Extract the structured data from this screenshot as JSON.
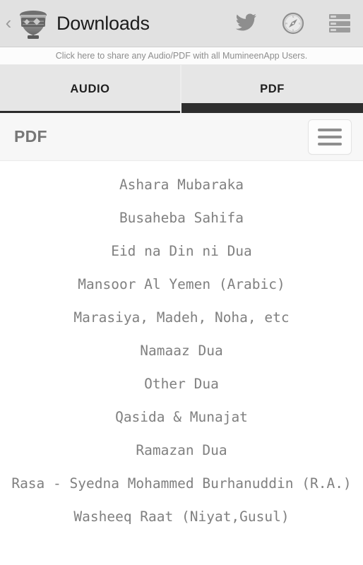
{
  "header": {
    "back_label": "‹",
    "logo_icon": "urn-logo-icon",
    "title": "Downloads",
    "actions": [
      {
        "name": "twitter-icon",
        "label": "Twitter"
      },
      {
        "name": "compass-icon",
        "label": "Browser"
      },
      {
        "name": "list-menu-icon",
        "label": "Menu"
      }
    ]
  },
  "share_banner": {
    "text": "Click here to share any Audio/PDF with all MumineenApp Users."
  },
  "tabs": [
    {
      "label": "AUDIO",
      "active": false
    },
    {
      "label": "PDF",
      "active": true
    }
  ],
  "section": {
    "title": "PDF",
    "menu_icon": "hamburger-icon"
  },
  "pdf_list": {
    "items": [
      "Ashara Mubaraka",
      "Busaheba Sahifa",
      "Eid na Din ni Dua",
      "Mansoor Al Yemen (Arabic)",
      "Marasiya, Madeh, Noha, etc",
      "Namaaz Dua",
      "Other Dua",
      "Qasida & Munajat",
      "Ramazan Dua",
      "Rasa - Syedna Mohammed Burhanuddin (R.A.)",
      "Washeeq Raat (Niyat,Gusul)"
    ]
  },
  "colors": {
    "appbar_bg": "#e1e1e1",
    "tabbar_bg": "#e6e6e6",
    "tab_active_underline": "#2e2e2e",
    "section_bg": "#f7f7f7",
    "list_text": "#808080",
    "icon_gray": "#9c9c9c"
  }
}
